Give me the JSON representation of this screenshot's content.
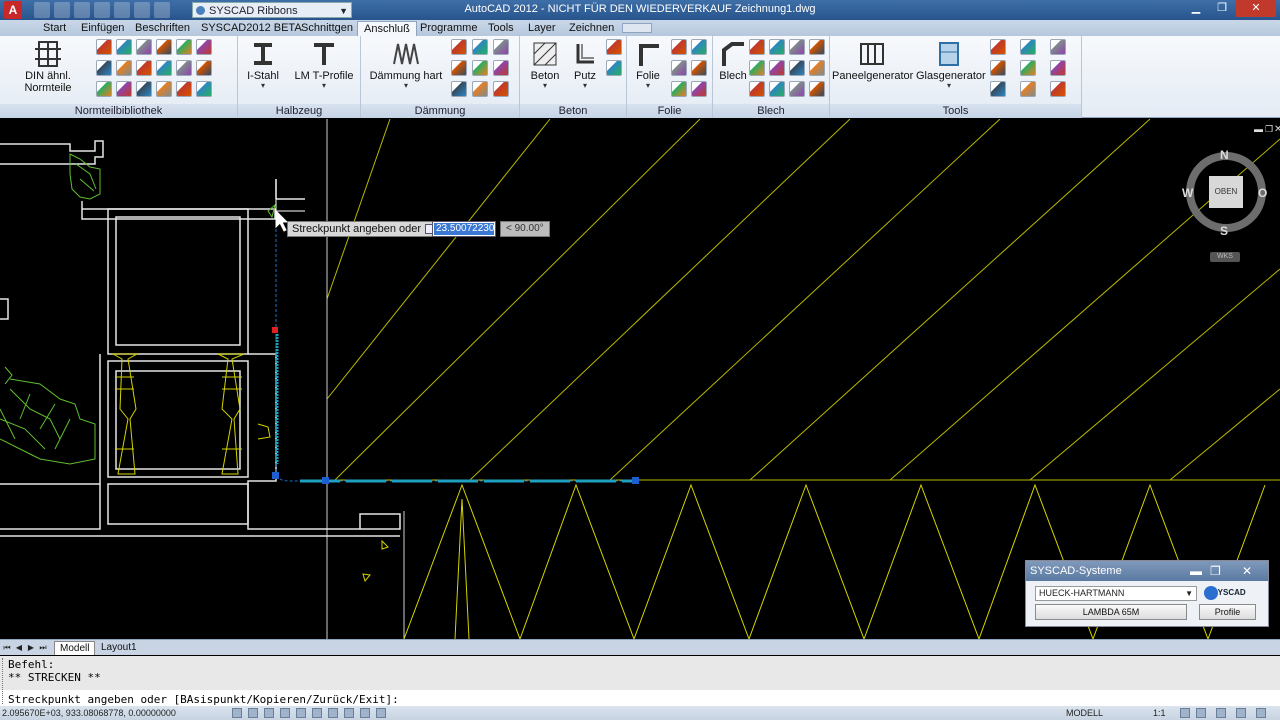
{
  "window": {
    "title": "AutoCAD 2012 - NICHT FÜR DEN WIEDERVERKAUF   Zeichnung1.dwg",
    "workspace": "SYSCAD Ribbons"
  },
  "tabs": [
    "Start",
    "Einfügen",
    "Beschriften",
    "SYSCAD2012 BETA",
    "Schnittgen",
    "Anschluß",
    "Programme",
    "Tools",
    "Layer",
    "Zeichnen"
  ],
  "active_tab": "Anschluß",
  "ribbon": {
    "normteil": {
      "title": "Normteilbibliothek",
      "big_label": "DIN ähnl. Normteile"
    },
    "halbzeug": {
      "title": "Halbzeug",
      "btn1": "I-Stahl",
      "btn2": "LM T-Profile"
    },
    "daemmung": {
      "title": "Dämmung",
      "btn1": "Dämmung hart"
    },
    "beton": {
      "title": "Beton",
      "btn1": "Beton",
      "btn2": "Putz"
    },
    "folie": {
      "title": "Folie",
      "btn1": "Folie"
    },
    "blech": {
      "title": "Blech",
      "btn1": "Blech"
    },
    "tools": {
      "title": "Tools",
      "btn1": "Paneelgenerator",
      "btn2": "Glasgenerator"
    }
  },
  "icon_colors": [
    "#c0392b",
    "#2e86c1",
    "#7f8c8d",
    "#d35400",
    "#27ae60",
    "#8e44ad",
    "#34495e",
    "#e67e22"
  ],
  "drawing": {
    "tooltip_text": "Streckpunkt angeben oder",
    "dyn_value": "23.50072230",
    "dyn_angle": "< 90.00°"
  },
  "viewcube": {
    "n": "N",
    "s": "S",
    "w": "W",
    "e": "O",
    "face": "OBEN",
    "wcs": "WKS"
  },
  "syscad_dialog": {
    "title": "SYSCAD-Systeme",
    "system": "HUECK-HARTMANN",
    "logo": "SYSCAD",
    "series_button": "LAMBDA 65M",
    "profile_button": "Profile"
  },
  "layout_tabs": [
    "Modell",
    "Layout1"
  ],
  "command": {
    "history1": "Befehl:",
    "history2": "** STRECKEN **",
    "prompt": "Streckpunkt angeben oder [BAsispunkt/Kopieren/Zurück/Exit]:"
  },
  "status": {
    "coords": "2.095670E+03, 933.08068778, 0.00000000",
    "model": "MODELL",
    "scale": "1:1"
  }
}
